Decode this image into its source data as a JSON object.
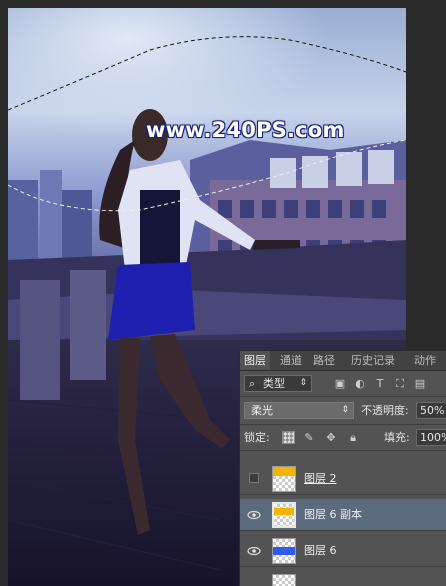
{
  "watermark": "www.240PS.com",
  "panel": {
    "tabs": [
      "图层",
      "通道",
      "路径",
      "历史记录",
      "动作"
    ],
    "filter_kind": "类型",
    "blend_mode": "柔光",
    "opacity_label": "不透明度:",
    "opacity_value": "50%",
    "lock_label": "锁定:",
    "fill_label": "填充:",
    "fill_value": "100%",
    "layers": [
      {
        "name": "图层 2",
        "visible": false,
        "selected": false,
        "thumb": "yellow"
      },
      {
        "name": "图层 6 副本",
        "visible": true,
        "selected": true,
        "thumb": "yellow-blend"
      },
      {
        "name": "图层 6",
        "visible": true,
        "selected": false,
        "thumb": "blue"
      }
    ]
  },
  "colors": {
    "panel_bg": "#535353",
    "selected_layer": "#5b6a7d",
    "dress": "#1f1fb0"
  }
}
